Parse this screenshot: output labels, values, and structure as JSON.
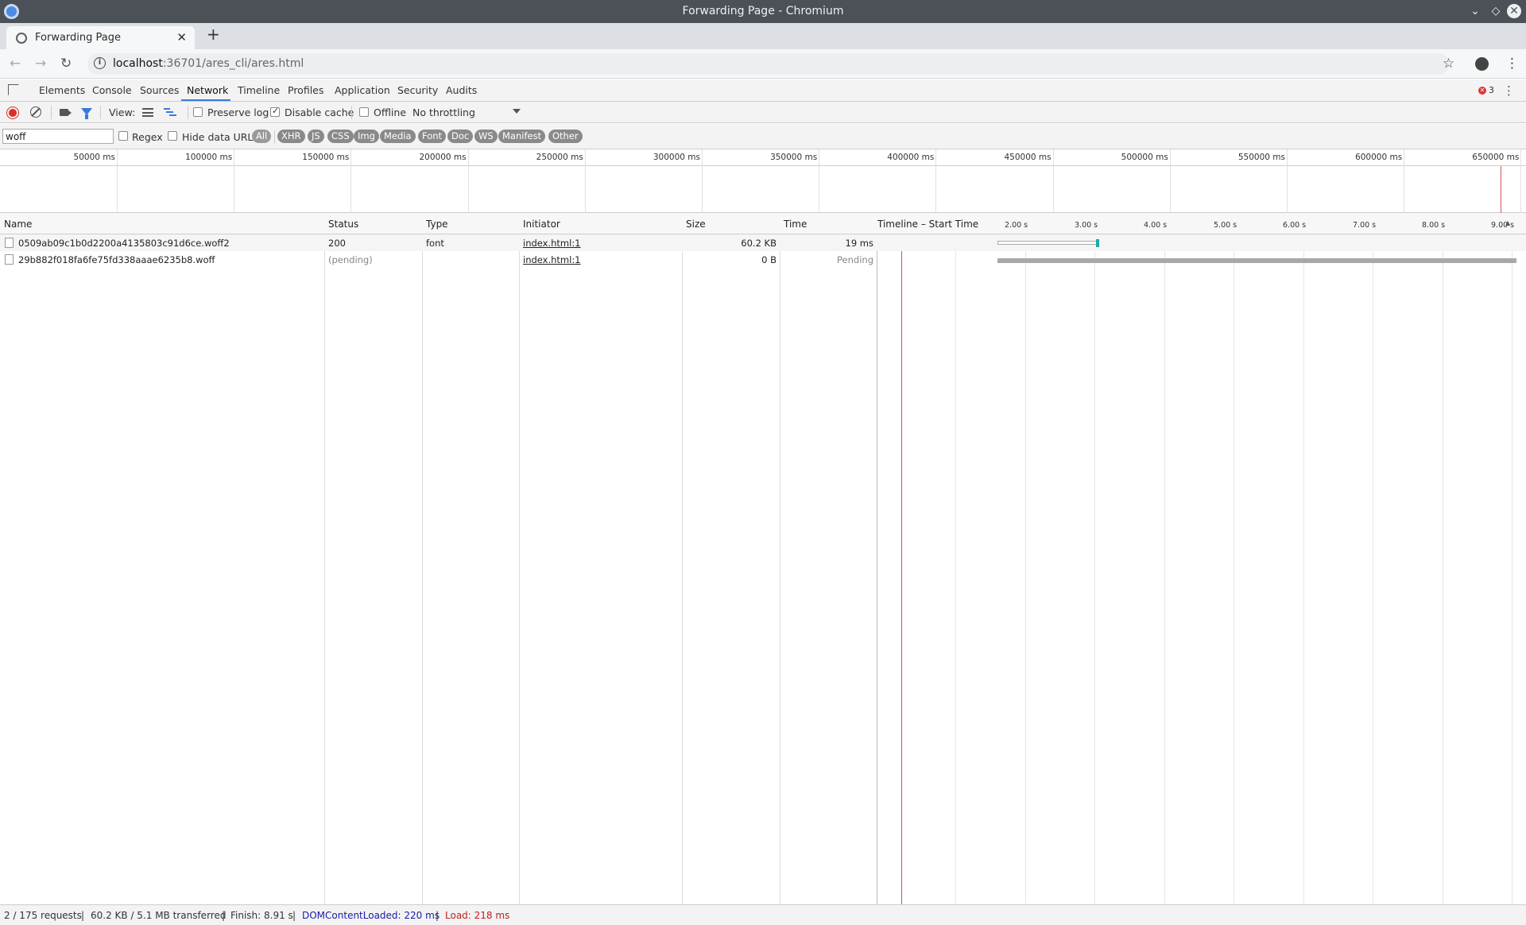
{
  "window": {
    "title": "Forwarding Page - Chromium"
  },
  "tabs": [
    {
      "label": "Forwarding Page"
    }
  ],
  "omnibox": {
    "host": "localhost",
    "path": ":36701/ares_cli/ares.html"
  },
  "devtools": {
    "tabs": [
      "Elements",
      "Console",
      "Sources",
      "Network",
      "Timeline",
      "Profiles",
      "Application",
      "Security",
      "Audits"
    ],
    "active_tab": "Network",
    "error_count": "3"
  },
  "network_toolbar": {
    "view_label": "View:",
    "preserve_log": "Preserve log",
    "disable_cache": "Disable cache",
    "offline": "Offline",
    "throttling": "No throttling"
  },
  "filter": {
    "value": "woff",
    "regex": "Regex",
    "hide_data_urls": "Hide data URLs",
    "types": [
      "All",
      "XHR",
      "JS",
      "CSS",
      "Img",
      "Media",
      "Font",
      "Doc",
      "WS",
      "Manifest",
      "Other"
    ]
  },
  "overview": {
    "ticks": [
      "50000 ms",
      "100000 ms",
      "150000 ms",
      "200000 ms",
      "250000 ms",
      "300000 ms",
      "350000 ms",
      "400000 ms",
      "450000 ms",
      "500000 ms",
      "550000 ms",
      "600000 ms",
      "650000 ms"
    ]
  },
  "grid": {
    "headers": [
      "Name",
      "Status",
      "Type",
      "Initiator",
      "Size",
      "Time",
      "Timeline – Start Time"
    ],
    "waterfall_ticks": [
      "2.00 s",
      "3.00 s",
      "4.00 s",
      "5.00 s",
      "6.00 s",
      "7.00 s",
      "8.00 s",
      "9.00 s"
    ],
    "rows": [
      {
        "name": "0509ab09c1b0d2200a4135803c91d6ce.woff2",
        "status": "200",
        "type": "font",
        "initiator": "index.html:1",
        "size": "60.2 KB",
        "time": "19 ms"
      },
      {
        "name": "29b882f018fa6fe75fd338aaae6235b8.woff",
        "status": "(pending)",
        "type": "",
        "initiator": "index.html:1",
        "size": "0 B",
        "time": "Pending"
      }
    ]
  },
  "status": {
    "requests": "2 / 175 requests",
    "transferred": "60.2 KB / 5.1 MB transferred",
    "finish": "Finish: 8.91 s",
    "dcl": "DOMContentLoaded: 220 ms",
    "load": "Load: 218 ms"
  }
}
